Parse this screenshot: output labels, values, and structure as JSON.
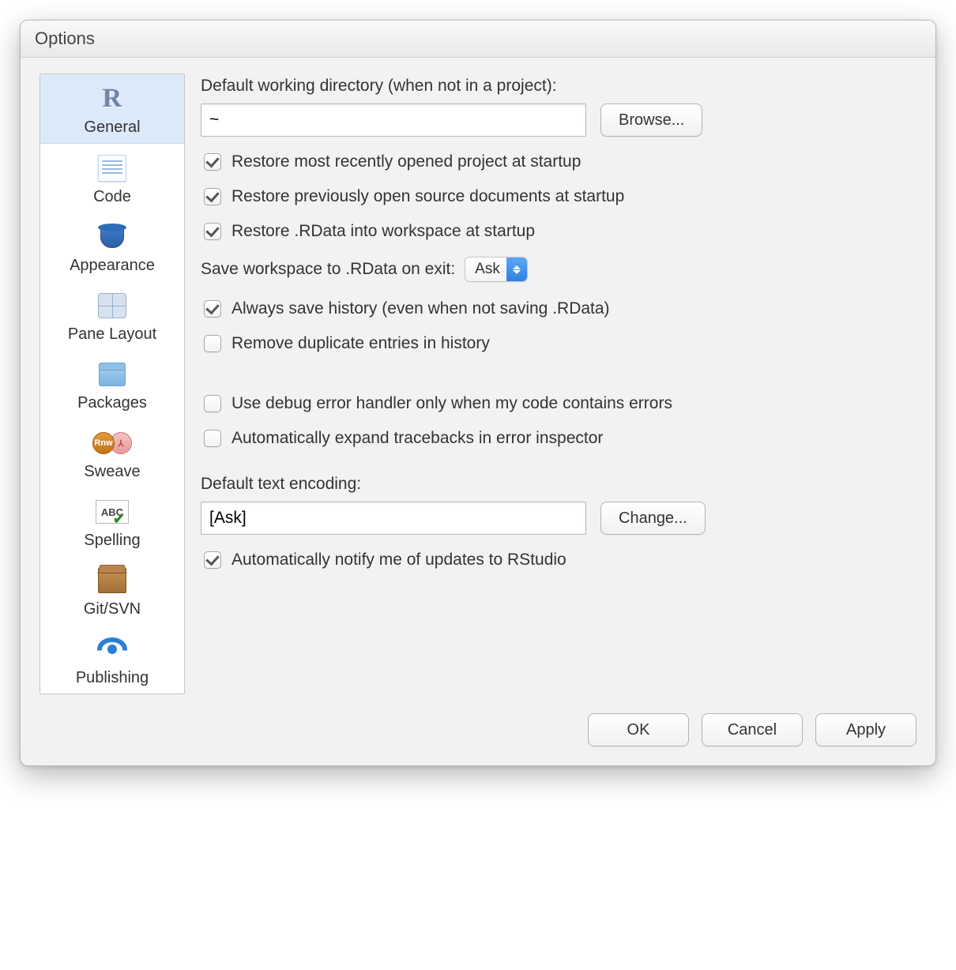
{
  "window": {
    "title": "Options"
  },
  "sidebar": {
    "items": [
      {
        "label": "General"
      },
      {
        "label": "Code"
      },
      {
        "label": "Appearance"
      },
      {
        "label": "Pane Layout"
      },
      {
        "label": "Packages"
      },
      {
        "label": "Sweave"
      },
      {
        "label": "Spelling"
      },
      {
        "label": "Git/SVN"
      },
      {
        "label": "Publishing"
      }
    ]
  },
  "main": {
    "workdir_label": "Default working directory (when not in a project):",
    "workdir_value": "~",
    "browse_label": "Browse...",
    "chk_restore_project": "Restore most recently opened project at startup",
    "chk_restore_docs": "Restore previously open source documents at startup",
    "chk_restore_rdata": "Restore .RData into workspace at startup",
    "save_ws_label": "Save workspace to .RData on exit:",
    "save_ws_value": "Ask",
    "chk_always_save_history": "Always save history (even when not saving .RData)",
    "chk_remove_dup_history": "Remove duplicate entries in history",
    "chk_use_debug_handler": "Use debug error handler only when my code contains errors",
    "chk_auto_expand_tracebacks": "Automatically expand tracebacks in error inspector",
    "encoding_label": "Default text encoding:",
    "encoding_value": "[Ask]",
    "change_label": "Change...",
    "chk_notify_updates": "Automatically notify me of updates to RStudio"
  },
  "footer": {
    "ok": "OK",
    "cancel": "Cancel",
    "apply": "Apply"
  },
  "rnw_badge": "Rnw"
}
